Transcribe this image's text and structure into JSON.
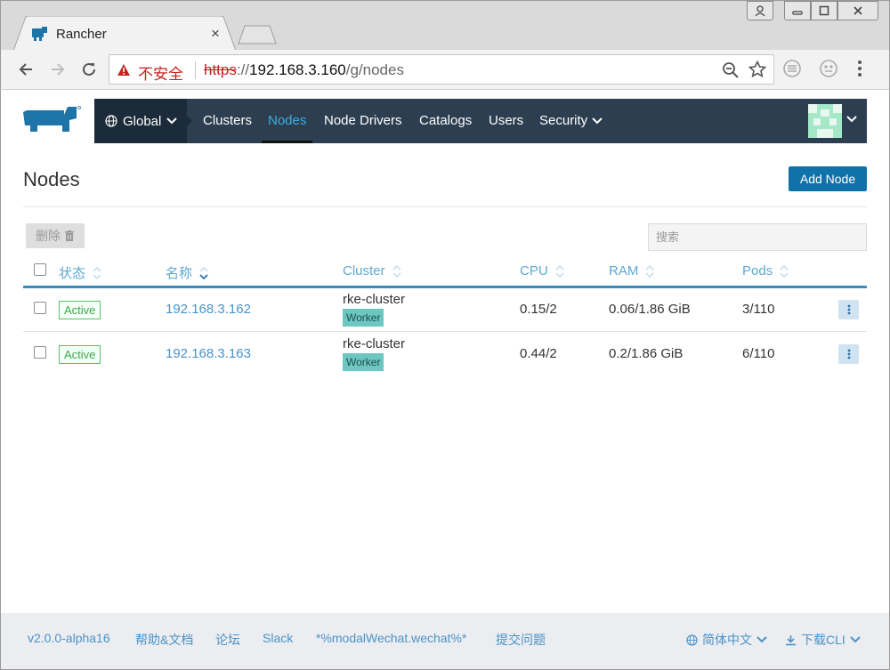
{
  "browser": {
    "tab_title": "Rancher",
    "tab_close": "×",
    "security_label": "不安全",
    "url_scheme": "https",
    "url_sep": "://",
    "url_host": "192.168.3.160",
    "url_path": "/g/nodes"
  },
  "header": {
    "global_label": "Global",
    "nav": {
      "clusters": "Clusters",
      "nodes": "Nodes",
      "node_drivers": "Node Drivers",
      "catalogs": "Catalogs",
      "users": "Users",
      "security": "Security"
    },
    "active_nav": "Nodes"
  },
  "page": {
    "title": "Nodes",
    "add_button": "Add Node",
    "delete_button": "删除",
    "search_placeholder": "搜索"
  },
  "table": {
    "columns": {
      "state": "状态",
      "name": "名称",
      "cluster": "Cluster",
      "cpu": "CPU",
      "ram": "RAM",
      "pods": "Pods"
    },
    "rows": [
      {
        "state": "Active",
        "name": "192.168.3.162",
        "cluster": "rke-cluster",
        "role": "Worker",
        "cpu": "0.15/2",
        "ram": "0.06/1.86 GiB",
        "pods": "3/110"
      },
      {
        "state": "Active",
        "name": "192.168.3.163",
        "cluster": "rke-cluster",
        "role": "Worker",
        "cpu": "0.44/2",
        "ram": "0.2/1.86 GiB",
        "pods": "6/110"
      }
    ]
  },
  "footer": {
    "version": "v2.0.0-alpha16",
    "help": "帮助&文档",
    "forum": "论坛",
    "slack": "Slack",
    "wechat": "*%modalWechat.wechat%*",
    "issue": "提交问题",
    "language": "简体中文",
    "download_cli": "下载CLI"
  },
  "colors": {
    "header_bg": "#2c3e50",
    "accent": "#0f73a9",
    "link": "#4a93c7",
    "active_badge": "#56c167",
    "worker_badge": "#6cc6c2"
  }
}
